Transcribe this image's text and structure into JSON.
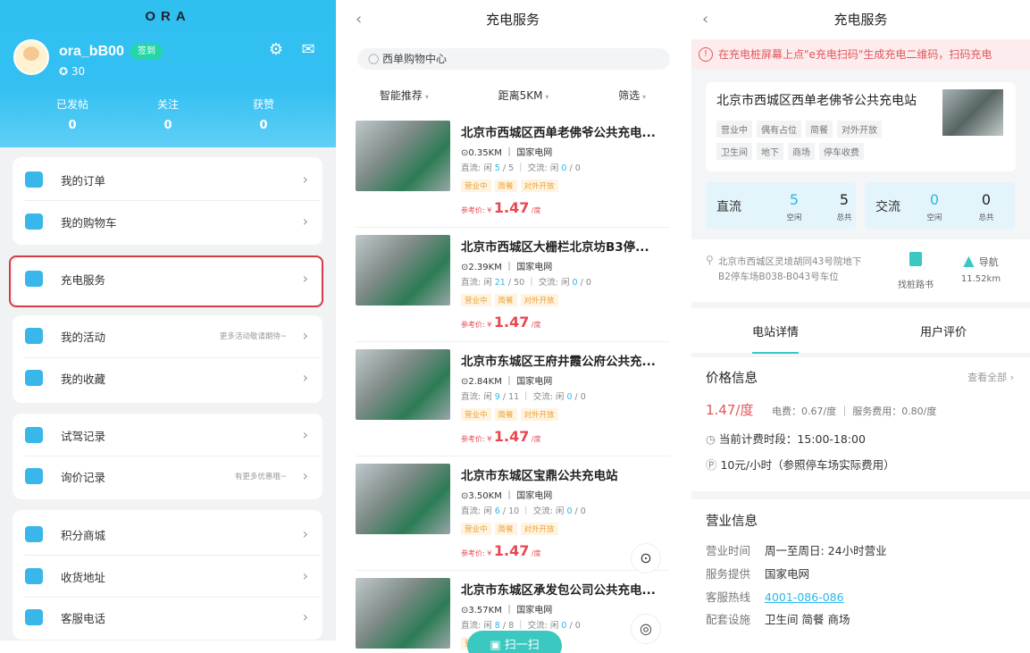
{
  "brand": {
    "logo": "ORA"
  },
  "profile": {
    "username": "ora_bB00",
    "checkin_label": "签到",
    "points": "30",
    "stats": [
      {
        "label": "已发帖",
        "value": "0"
      },
      {
        "label": "关注",
        "value": "0"
      },
      {
        "label": "获赞",
        "value": "0"
      }
    ]
  },
  "menu": {
    "group1": [
      {
        "label": "我的订单",
        "icon": "order-icon"
      },
      {
        "label": "我的购物车",
        "icon": "cart-icon"
      }
    ],
    "group2": [
      {
        "label": "充电服务",
        "icon": "charging-icon"
      }
    ],
    "group3": [
      {
        "label": "我的活动",
        "hint": "更多活动敬请期待~",
        "icon": "activity-icon"
      },
      {
        "label": "我的收藏",
        "icon": "favorite-icon"
      }
    ],
    "group4": [
      {
        "label": "试驾记录",
        "icon": "steering-wheel-icon"
      },
      {
        "label": "询价记录",
        "hint": "有更多优惠哦~",
        "icon": "price-icon"
      }
    ],
    "group5": [
      {
        "label": "积分商城",
        "icon": "points-mall-icon"
      },
      {
        "label": "收货地址",
        "icon": "location-icon"
      },
      {
        "label": "客服电话",
        "icon": "phone-icon"
      }
    ]
  },
  "charging_list": {
    "title": "充电服务",
    "search_value": "西单购物中心",
    "filters": [
      "智能推荐",
      "距离5KM",
      "筛选"
    ],
    "stations": [
      {
        "name": "北京市西城区西单老佛爷公共充电...",
        "distance": "0.35KM",
        "operator": "国家电网",
        "dc_label": "直流: 闲",
        "dc_free": "5",
        "dc_total": "5",
        "ac_label": "交流: 闲",
        "ac_free": "0",
        "ac_total": "0",
        "tags": [
          "营业中",
          "简餐",
          "对外开放"
        ],
        "price_label": "参考价: ¥",
        "price": "1.47",
        "unit": "/度"
      },
      {
        "name": "北京市西城区大栅栏北京坊B3停...",
        "distance": "2.39KM",
        "operator": "国家电网",
        "dc_label": "直流: 闲",
        "dc_free": "21",
        "dc_total": "50",
        "ac_label": "交流: 闲",
        "ac_free": "0",
        "ac_total": "0",
        "tags": [
          "营业中",
          "简餐",
          "对外开放"
        ],
        "price_label": "参考价: ¥",
        "price": "1.47",
        "unit": "/度"
      },
      {
        "name": "北京市东城区王府井霞公府公共充...",
        "distance": "2.84KM",
        "operator": "国家电网",
        "dc_label": "直流: 闲",
        "dc_free": "9",
        "dc_total": "11",
        "ac_label": "交流: 闲",
        "ac_free": "0",
        "ac_total": "0",
        "tags": [
          "营业中",
          "简餐",
          "对外开放"
        ],
        "price_label": "参考价: ¥",
        "price": "1.47",
        "unit": "/度"
      },
      {
        "name": "北京市东城区宝鼎公共充电站",
        "distance": "3.50KM",
        "operator": "国家电网",
        "dc_label": "直流: 闲",
        "dc_free": "6",
        "dc_total": "10",
        "ac_label": "交流: 闲",
        "ac_free": "0",
        "ac_total": "0",
        "tags": [
          "营业中",
          "简餐",
          "对外开放"
        ],
        "price_label": "参考价: ¥",
        "price": "1.47",
        "unit": "/度"
      },
      {
        "name": "北京市东城区承发包公司公共充电...",
        "distance": "3.57KM",
        "operator": "国家电网",
        "dc_label": "直流: 闲",
        "dc_free": "8",
        "dc_total": "8",
        "ac_label": "交流: 闲",
        "ac_free": "0",
        "ac_total": "0",
        "tags": [
          "营业中"
        ],
        "price_label": "",
        "price": "",
        "unit": ""
      }
    ],
    "scan_label": "扫一扫"
  },
  "station_detail": {
    "title": "充电服务",
    "warning": "在充电桩屏幕上点\"e充电扫码\"生成充电二维码，扫码充电",
    "name": "北京市西城区西单老佛爷公共充电站",
    "tags_row1": [
      "营业中",
      "偶有占位",
      "简餐",
      "对外开放"
    ],
    "tags_row2": [
      "卫生间",
      "地下",
      "商场",
      "停车收费"
    ],
    "dc": {
      "label": "直流",
      "free": "5",
      "free_label": "空闲",
      "total": "5",
      "total_label": "总共"
    },
    "ac": {
      "label": "交流",
      "free": "0",
      "free_label": "空闲",
      "total": "0",
      "total_label": "总共"
    },
    "address": "北京市西城区灵境胡同43号院地下B2停车场B038-B043号车位",
    "guide_label": "找桩路书",
    "nav_label": "导航",
    "nav_distance": "11.52km",
    "tabs": [
      "电站详情",
      "用户评价"
    ],
    "price_info": {
      "heading": "价格信息",
      "view_all": "查看全部",
      "price": "1.47/度",
      "breakdown": "电费：0.67/度 ｜ 服务费用：0.80/度",
      "period": "当前计费时段：15:00-18:00",
      "parking": "10元/小时（参照停车场实际费用）"
    },
    "business_info": {
      "heading": "营业信息",
      "rows": [
        {
          "k": "营业时间",
          "v": "周一至周日: 24小时营业"
        },
        {
          "k": "服务提供",
          "v": "国家电网"
        },
        {
          "k": "客服热线",
          "v": "4001-086-086"
        },
        {
          "k": "配套设施",
          "v": "卫生间 简餐 商场"
        }
      ]
    }
  },
  "colors": {
    "accent": "#3ac8c0",
    "header": "#34bff2",
    "price": "#e8484f",
    "highlight": "#d33d45"
  }
}
